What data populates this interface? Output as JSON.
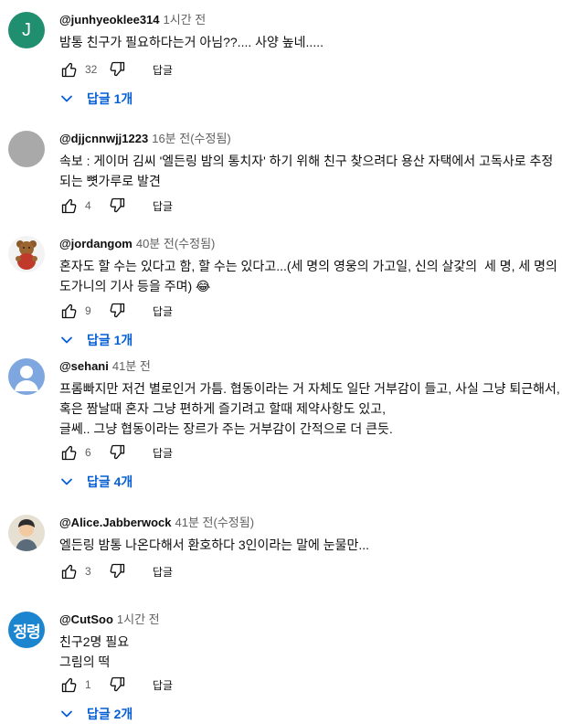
{
  "labels": {
    "reply": "답글"
  },
  "comments": [
    {
      "avatar": "J",
      "avatar_color": "#1f8f70",
      "author": "@junhyeoklee314",
      "time": "1시간 전",
      "text": "밤통 친구가 필요하다는거 아님??.... 사양 높네.....",
      "likes": "32",
      "replies": "답글 1개"
    },
    {
      "avatar_icon": "gray-circle-avatar",
      "author": "@djjcnnwjj1223",
      "time": "16분 전(수정됨)",
      "text": "속보 : 게이머 김씨 '엘든링 밤의 통치자' 하기 위해 친구 찾으려다 용산 자택에서 고독사로 추정되는 뼛가루로 발견",
      "likes": "4"
    },
    {
      "avatar_icon": "teddy-bear-avatar",
      "author": "@jordangom",
      "time": "40분 전(수정됨)",
      "text": "혼자도 할 수는 있다고 함, 할 수는 있다고...(세 명의 영웅의 가고일, 신의 살갗의  세 명, 세 명의 도가니의 기사 등을 주며) 😂",
      "likes": "9",
      "replies": "답글 1개"
    },
    {
      "avatar_icon": "default-person-avatar",
      "avatar_color": "#7ea7e0",
      "author": "@sehani",
      "time": "41분 전",
      "text": "프롬빠지만 저건 별로인거 가틈. 협동이라는 거 자체도 일단 거부감이 들고, 사실 그냥 퇴근해서, 혹은 짬날때 혼자 그냥 편하게 즐기려고 할때 제약사항도 있고,\n글쎄.. 그냥 협동이라는 장르가 주는 거부감이 간적으로 더 큰듯.",
      "likes": "6",
      "replies": "답글 4개"
    },
    {
      "avatar_icon": "child-photo-avatar",
      "author": "@Alice.Jabberwock",
      "time": "41분 전(수정됨)",
      "text": "엘든링 밤통 나온다해서 환호하다 3인이라는 말에 눈물만...",
      "likes": "3"
    },
    {
      "avatar": "정령",
      "avatar_color": "#1b86cf",
      "author": "@CutSoo",
      "time": "1시간 전",
      "text": "친구2명 필요\n그림의 떡",
      "likes": "1",
      "replies": "답글 2개"
    }
  ]
}
